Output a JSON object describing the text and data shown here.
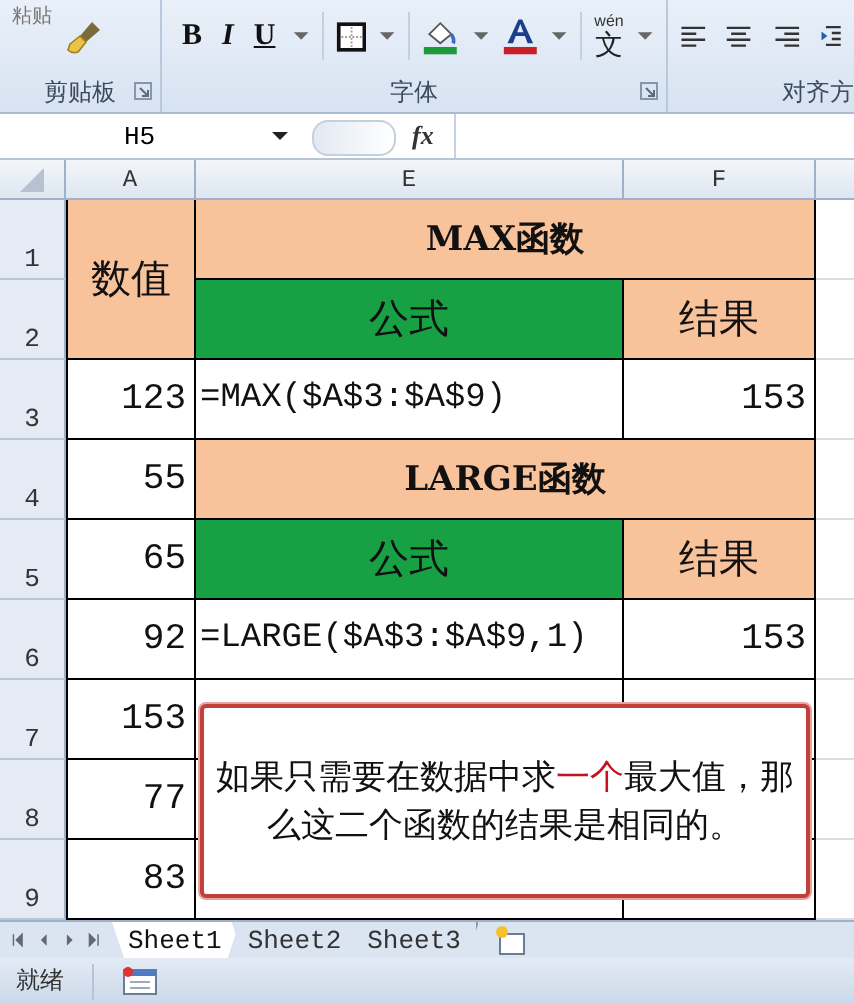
{
  "ribbon": {
    "paste_label": "粘贴",
    "format_buttons": [
      "B",
      "I",
      "U"
    ],
    "phonetic_button": {
      "pinyin": "wén",
      "glyph": "文"
    },
    "groups": [
      "剪贴板",
      "字体",
      "对齐方"
    ]
  },
  "formula_bar": {
    "name_box": "H5",
    "fx": "fx"
  },
  "sheet": {
    "columns": [
      "A",
      "E",
      "F"
    ],
    "rows": [
      {
        "header": "1",
        "cells": [
          {
            "kind": "header",
            "text": "数值",
            "rowspan": 2
          },
          {
            "kind": "title",
            "text": "MAX函数",
            "colspan": 2
          }
        ]
      },
      {
        "header": "2",
        "cells": [
          {
            "kind": "green",
            "text": "公式"
          },
          {
            "kind": "header",
            "text": "结果"
          }
        ]
      },
      {
        "header": "3",
        "cells": [
          {
            "kind": "number",
            "text": "123"
          },
          {
            "kind": "formula",
            "text": "=MAX($A$3:$A$9)"
          },
          {
            "kind": "number",
            "text": "153"
          }
        ]
      },
      {
        "header": "4",
        "cells": [
          {
            "kind": "number",
            "text": "55"
          },
          {
            "kind": "title",
            "text": "LARGE函数",
            "colspan": 2
          }
        ]
      },
      {
        "header": "5",
        "cells": [
          {
            "kind": "number",
            "text": "65"
          },
          {
            "kind": "green",
            "text": "公式"
          },
          {
            "kind": "header",
            "text": "结果"
          }
        ]
      },
      {
        "header": "6",
        "cells": [
          {
            "kind": "number",
            "text": "92"
          },
          {
            "kind": "formula",
            "text": "=LARGE($A$3:$A$9,1)"
          },
          {
            "kind": "number",
            "text": "153"
          }
        ]
      },
      {
        "header": "7",
        "cells": [
          {
            "kind": "number",
            "text": "153"
          }
        ]
      },
      {
        "header": "8",
        "cells": [
          {
            "kind": "number",
            "text": "77"
          }
        ]
      },
      {
        "header": "9",
        "cells": [
          {
            "kind": "number",
            "text": "83"
          }
        ]
      }
    ],
    "note": [
      {
        "text": "如果只需要在数据中求",
        "emphasis": false
      },
      {
        "text": "一个",
        "emphasis": true
      },
      {
        "text": "最大值，那么这二个函数的结果是相同的。",
        "emphasis": false
      }
    ]
  },
  "sheet_tabs": [
    {
      "label": "Sheet1",
      "selected": true
    },
    {
      "label": "Sheet2",
      "selected": false
    },
    {
      "label": "Sheet3",
      "selected": false
    }
  ],
  "status_bar": {
    "text": "就绪"
  }
}
